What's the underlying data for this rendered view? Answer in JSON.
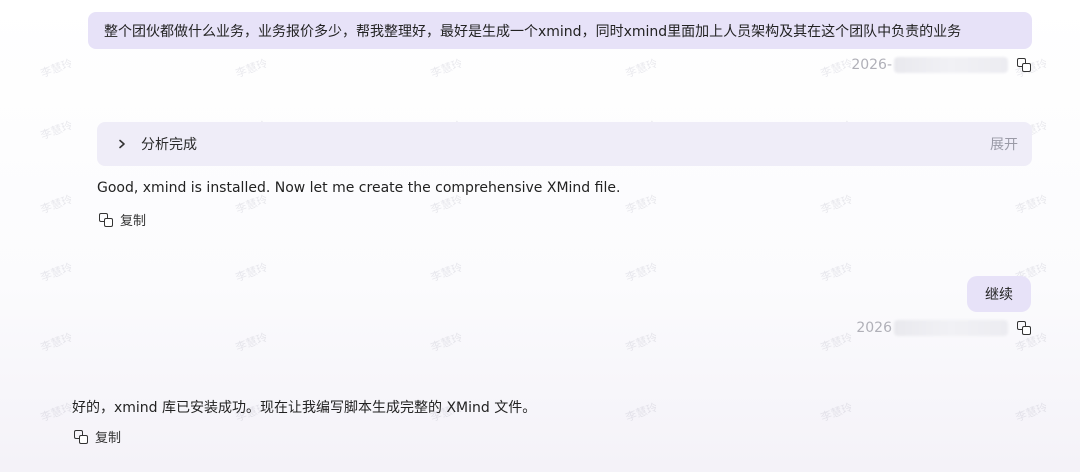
{
  "watermark": {
    "text": "李慧玲"
  },
  "messages": {
    "user_1": {
      "text": "整个团伙都做什么业务，业务报价多少，帮我整理好，最好是生成一个xmind，同时xmind里面加上人员架构及其在这个团队中负责的业务",
      "timestamp_prefix": "2026-"
    },
    "analysis": {
      "label": "分析完成",
      "expand_label": "展开"
    },
    "assistant_1": {
      "text": "Good, xmind is installed. Now let me create the comprehensive XMind file.",
      "copy_label": "复制"
    },
    "user_2": {
      "text": "继续",
      "timestamp_prefix": "2026"
    },
    "assistant_2": {
      "text": "好的，xmind 库已安装成功。现在让我编写脚本生成完整的 XMind 文件。",
      "copy_label": "复制"
    }
  },
  "colors": {
    "user_bubble": "#e7e2f8",
    "analysis_panel": "#efedf8",
    "timestamp": "#b0b0b8",
    "expand": "#9a9aa6"
  },
  "icons": {
    "copy": "copy-icon",
    "chevron": "chevron-right-icon"
  }
}
